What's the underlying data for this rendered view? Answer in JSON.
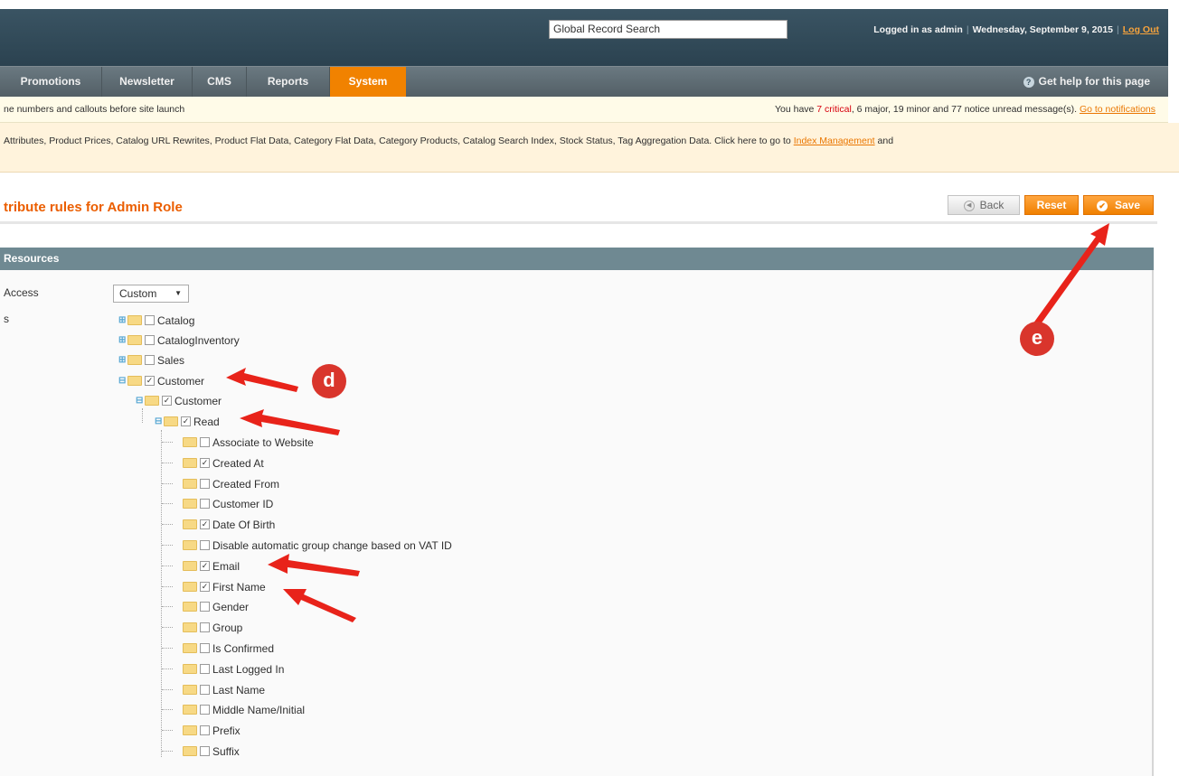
{
  "header": {
    "search_placeholder": "Global Record Search",
    "logged_in": "Logged in as admin",
    "date": "Wednesday, September 9, 2015",
    "logout": "Log Out"
  },
  "nav": {
    "items": [
      {
        "label": "Promotions"
      },
      {
        "label": "Newsletter"
      },
      {
        "label": "CMS"
      },
      {
        "label": "Reports"
      },
      {
        "label": "System",
        "active": true
      }
    ],
    "help": "Get help for this page"
  },
  "messages": {
    "notice_left": "ne numbers and callouts before site launch",
    "notice_right": {
      "prefix": "You have",
      "critical": "7 critical",
      "rest": ", 6 major, 19 minor and 77 notice unread message(s).",
      "link": "Go to notifications"
    },
    "index_text": "Attributes, Product Prices, Catalog URL Rewrites, Product Flat Data, Category Flat Data, Category Products, Catalog Search Index, Stock Status, Tag Aggregation Data. Click here to go to",
    "index_link": "Index Management",
    "index_tail": "and"
  },
  "page": {
    "title": "tribute rules for Admin Role",
    "back": "Back",
    "reset": "Reset",
    "save": "Save"
  },
  "section": {
    "title": "Resources",
    "access_label": "Access",
    "resources_label": "s",
    "access_value": "Custom"
  },
  "tree": {
    "catalog": "Catalog",
    "cataloginventory": "CatalogInventory",
    "sales": "Sales",
    "customer": "Customer",
    "customer_sub": "Customer",
    "read": "Read",
    "fields": [
      {
        "label": "Associate to Website",
        "checked": false
      },
      {
        "label": "Created At",
        "checked": true
      },
      {
        "label": "Created From",
        "checked": false
      },
      {
        "label": "Customer ID",
        "checked": false
      },
      {
        "label": "Date Of Birth",
        "checked": true
      },
      {
        "label": "Disable automatic group change based on VAT ID",
        "checked": false
      },
      {
        "label": "Email",
        "checked": true
      },
      {
        "label": "First Name",
        "checked": true
      },
      {
        "label": "Gender",
        "checked": false
      },
      {
        "label": "Group",
        "checked": false
      },
      {
        "label": "Is Confirmed",
        "checked": false
      },
      {
        "label": "Last Logged In",
        "checked": false
      },
      {
        "label": "Last Name",
        "checked": false
      },
      {
        "label": "Middle Name/Initial",
        "checked": false
      },
      {
        "label": "Prefix",
        "checked": false
      },
      {
        "label": "Suffix",
        "checked": false
      }
    ]
  },
  "callouts": {
    "d": "d",
    "e": "e"
  },
  "colors": {
    "accent": "#f18200",
    "title": "#eb5e00",
    "callout": "#d9352c"
  }
}
